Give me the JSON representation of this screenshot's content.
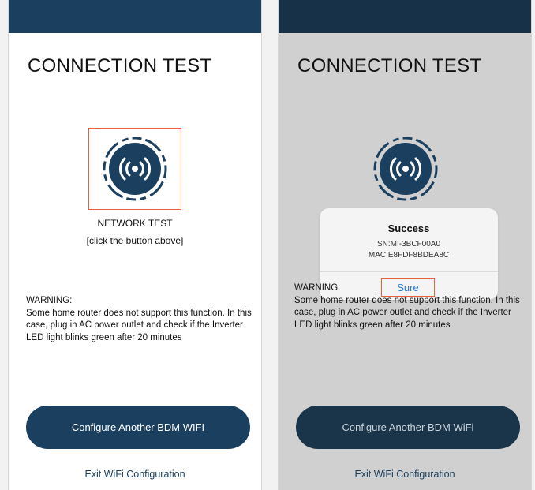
{
  "screen_left": {
    "title": "CONNECTION TEST",
    "network_label": "NETWORK TEST",
    "network_hint": "[click the button above]",
    "warning_heading": "WARNING:",
    "warning_body": "Some home router does not support this function. In this case, plug in AC power outlet and check if the Inverter LED light blinks green after 20 minutes",
    "configure_button": "Configure Another BDM WIFI",
    "exit_link": "Exit WiFi Configuration"
  },
  "screen_right": {
    "title": "CONNECTION TEST",
    "dialog": {
      "title": "Success",
      "sn": "SN:MI-3BCF00A0",
      "mac": "MAC:E8FDF8BDEA8C",
      "confirm_button": "Sure"
    },
    "warning_heading": "WARNING:",
    "warning_body": "Some home router does not support this function. In this case, plug in AC power outlet and check if the Inverter LED light blinks green after 20 minutes",
    "configure_button": "Configure Another BDM WiFi",
    "exit_link": "Exit WiFi Configuration"
  },
  "colors": {
    "brand_navy": "#1b3f5e",
    "highlight": "#e8603c",
    "link_blue": "#2a7bd6"
  },
  "icons": {
    "network": "wireless-signal-icon"
  }
}
